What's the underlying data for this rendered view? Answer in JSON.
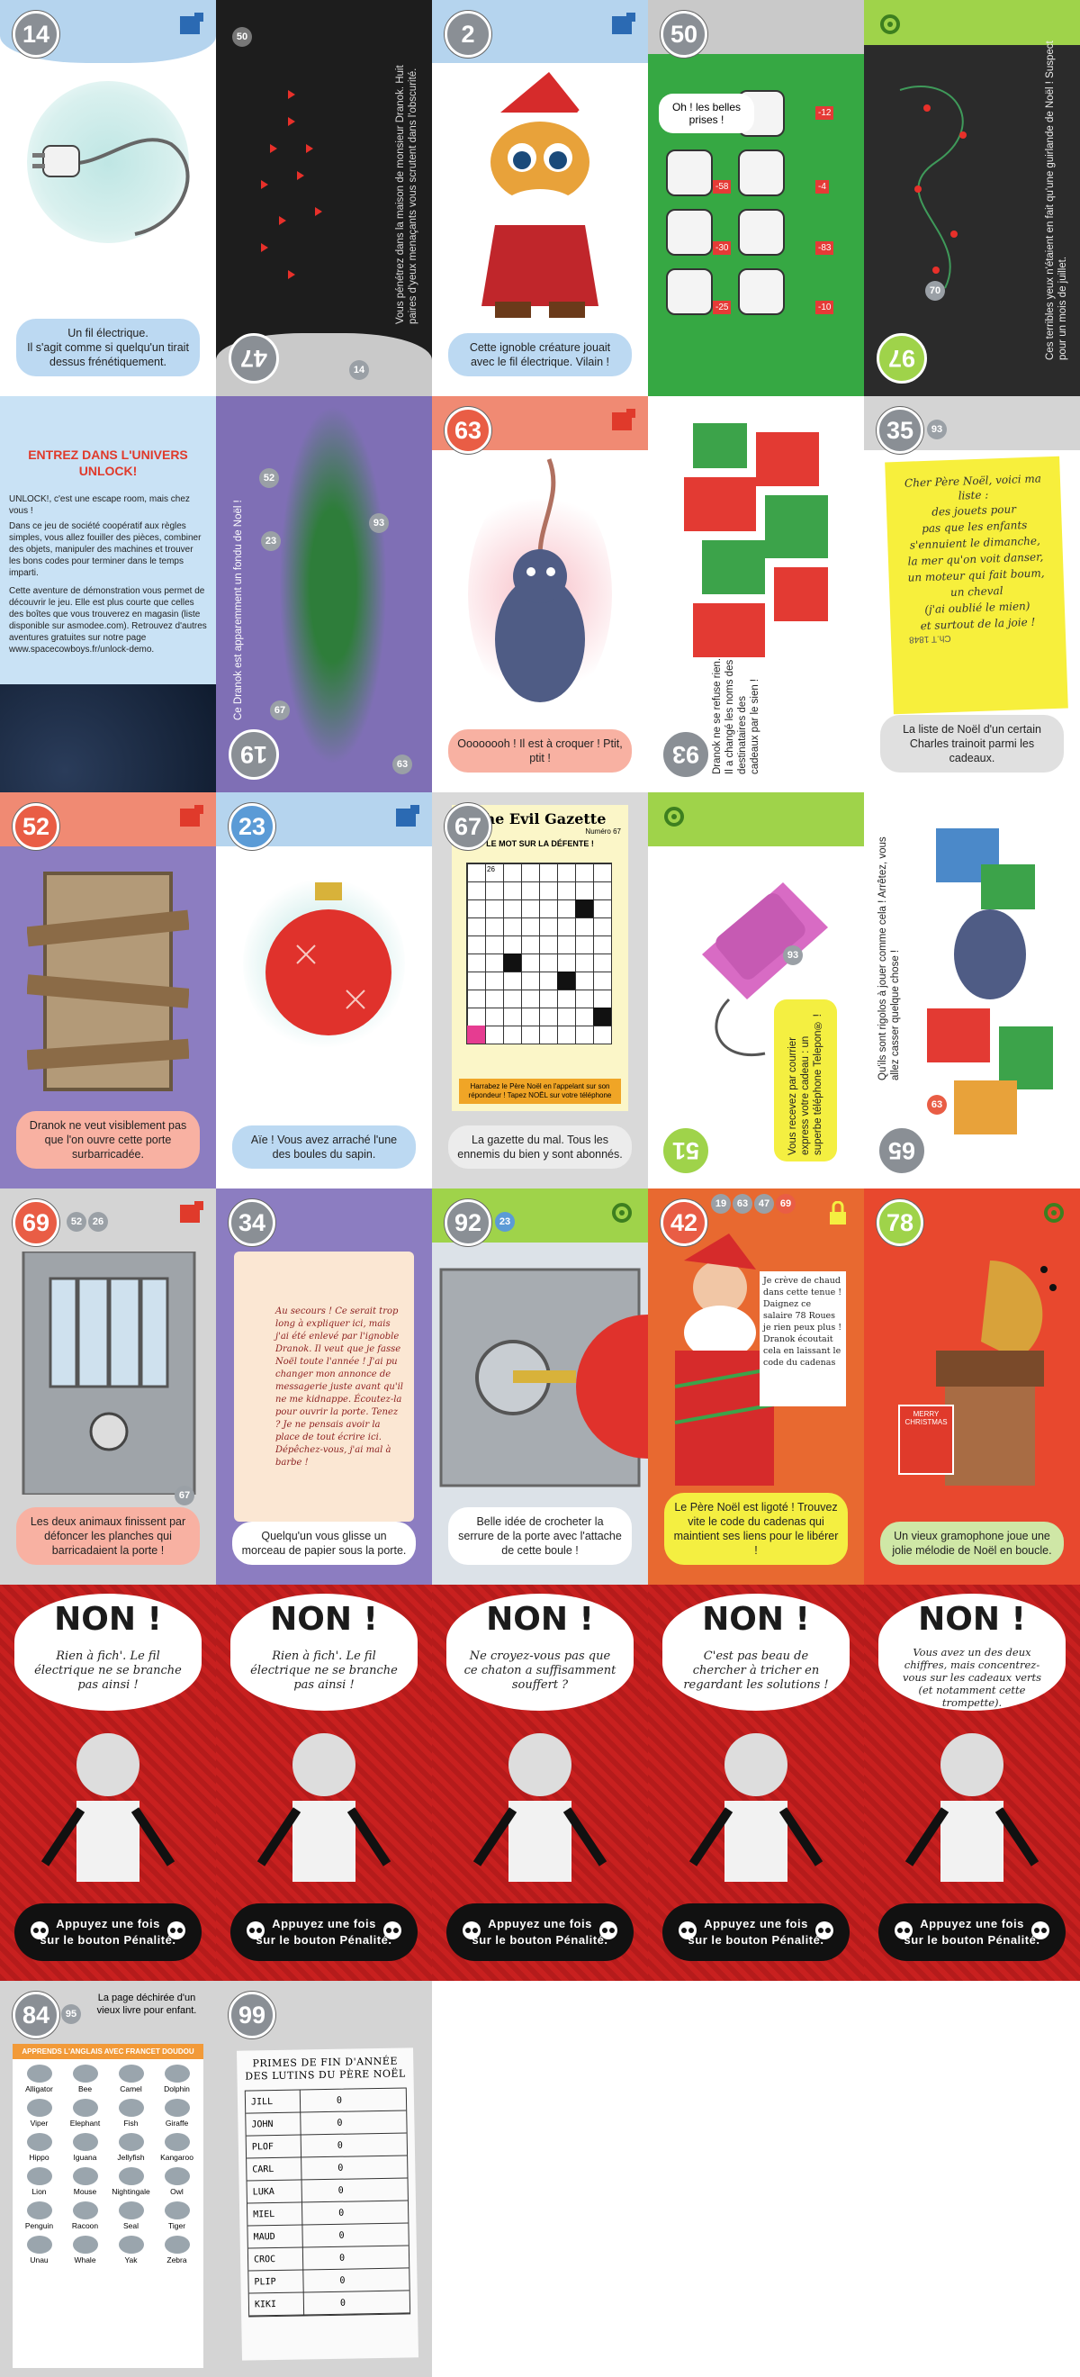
{
  "cards": {
    "c14": {
      "num": "14",
      "caption": "Un fil électrique.\nIl s'agit comme si quelqu'un tirait dessus frénétiquement."
    },
    "c47": {
      "num": "47",
      "small": "50",
      "small2": "14",
      "vert": "Vous pénétrez dans la maison de monsieur Dranok. Huit paires d'yeux menaçants vous scrutent dans l'obscurité."
    },
    "c2": {
      "num": "2",
      "caption": "Cette ignoble créature jouait avec le fil électrique. Vilain !"
    },
    "c50": {
      "num": "50",
      "bubble": "Oh ! les belles prises !",
      "tags": [
        "-12",
        "-58",
        "-4",
        "-30",
        "-83",
        "-25",
        "-10"
      ]
    },
    "c97": {
      "num": "97",
      "small": "70",
      "vert": "Ces terribles yeux n'étaient en fait qu'une guirlande de Noël ! Suspect pour un mois de juillet."
    },
    "intro": {
      "title": "ENTREZ DANS L'UNIVERS UNLOCK!",
      "p1": "UNLOCK!, c'est une escape room, mais chez vous !",
      "p2": "Dans ce jeu de société coopératif aux règles simples, vous allez fouiller des pièces, combiner des objets, manipuler des machines et trouver les bons codes pour terminer dans le temps imparti.",
      "p3": "Cette aventure de démonstration vous permet de découvrir le jeu. Elle est plus courte que celles des boîtes que vous trouverez en magasin (liste disponible sur asmodee.com). Retrouvez d'autres aventures gratuites sur notre page www.spacecowboys.fr/unlock-demo."
    },
    "c19": {
      "num": "19",
      "vert": "Ce Dranok est apparemment un fondu de Noël !",
      "n52": "52",
      "n23": "23",
      "n93": "93",
      "n63": "63",
      "n67": "67"
    },
    "c63": {
      "num": "63",
      "caption": "Oooooooh ! Il est à croquer ! Ptit, ptit !"
    },
    "c93": {
      "num": "93",
      "vert": "Dranok ne se refuse rien. Il a changé les noms des destinataires des cadeaux par le sien !"
    },
    "c35": {
      "num": "35",
      "small": "93",
      "letter": [
        "Cher Père Noël, voici ma liste :",
        "des jouets pour",
        "pas que les enfants",
        "s'ennuient le dimanche,",
        "la mer qu'on voit danser,",
        "un moteur qui fait boum,",
        "un cheval",
        "(j'ai oublié le mien)",
        "et surtout de la joie !"
      ],
      "sign": "Ch.T 1848",
      "caption": "La liste de Noël d'un certain Charles trainoit parmi les cadeaux."
    },
    "c52": {
      "num": "52",
      "caption": "Dranok ne veut visiblement pas que l'on ouvre cette porte surbarricadée."
    },
    "c23": {
      "num": "23",
      "caption": "Aïe ! Vous avez arraché l'une des boules du sapin."
    },
    "c67": {
      "num": "67",
      "gazette": "The Evil Gazette",
      "sub": "Numéro 67",
      "headline": "LE MOT SUR LA DÉFENTE !",
      "grid_num": "26",
      "note": "Harrabez le Père Noël en l'appelant sur son répondeur ! Tapez NOËL sur votre téléphone",
      "caption": "La gazette du mal. Tous les ennemis du bien y sont abonnés."
    },
    "c51": {
      "num": "51",
      "small": "93",
      "vert": "Vous recevez par courrier express votre cadeau : un superbe téléphone Telepon® !"
    },
    "c65": {
      "num": "65",
      "small": "63",
      "vert": "Qu'ils sont rigolos à jouer comme cela ! Arrêtez, vous allez casser quelque chose !"
    },
    "c69": {
      "num": "69",
      "small": [
        "52",
        "26"
      ],
      "n67": "67",
      "caption": "Les deux animaux finissent par défoncer les planches qui barricadaient la porte !"
    },
    "c34": {
      "num": "34",
      "scroll": "Au secours ! Ce serait trop long à expliquer ici, mais j'ai été enlevé par l'ignoble Dranok. Il veut que je fasse Noël toute l'année ! J'ai pu changer mon annonce de messagerie juste avant qu'il ne me kidnappe. Écoutez-la pour ouvrir la porte. Tenez ? Je ne pensais avoir la place de tout écrire ici. Dépêchez-vous, j'ai mal à barbe !",
      "caption": "Quelqu'un vous glisse un morceau de papier sous la porte."
    },
    "c92": {
      "num": "92",
      "small": "23",
      "caption": "Belle idée de crocheter la serrure de la porte avec l'attache de cette boule !"
    },
    "c42": {
      "num": "42",
      "small": [
        "19",
        "63",
        "47",
        "69"
      ],
      "sign": "Je crève de chaud dans cette tenue ! Daignez ce salaire 78 Roues je rien peux plus ! Dranok écoutait cela en laissant le code du cadenas",
      "caption": "Le Père Noël est ligoté ! Trouvez vite le code du cadenas qui maintient ses liens pour le libérer !"
    },
    "c78": {
      "num": "78",
      "record": "MERRY CHRISTMAS",
      "caption": "Un vieux gramophone joue une jolie mélodie de Noël en boucle."
    },
    "non": [
      {
        "title": "NON !",
        "text": "Rien à fich'. Le fil électrique ne se branche pas ainsi !"
      },
      {
        "title": "NON !",
        "text": "Rien à fich'. Le fil électrique ne se branche pas ainsi !"
      },
      {
        "title": "NON !",
        "text": "Ne croyez-vous pas que ce chaton a suffisamment souffert ?"
      },
      {
        "title": "NON !",
        "text": "C'est pas beau de chercher à tricher en regardant les solutions !"
      },
      {
        "title": "NON !",
        "text": "Vous avez un des deux chiffres, mais concentrez-vous sur les cadeaux verts (et notamment cette trompette)."
      }
    ],
    "penalty": [
      "Appuyez une fois",
      "sur le bouton Pénalité."
    ],
    "c84": {
      "num": "84",
      "small": "95",
      "top": "La page déchirée d'un vieux livre pour enfant.",
      "header": "APPRENDS L'ANGLAIS AVEC FRANCET DOUDOU",
      "animals": [
        "Alligator",
        "Bee",
        "Camel",
        "Dolphin",
        "Viper",
        "Elephant",
        "Fish",
        "Giraffe",
        "Hippo",
        "Iguana",
        "Jellyfish",
        "Kangaroo",
        "Lion",
        "Mouse",
        "Nightingale",
        "Owl",
        "Penguin",
        "Racoon",
        "Seal",
        "Tiger",
        "Unau",
        "Whale",
        "Yak",
        "Zebra"
      ]
    },
    "c99": {
      "num": "99",
      "title": "PRIMES DE FIN D'ANNÉE DES LUTINS DU PÈRE NOËL",
      "rows": [
        [
          "JILL",
          "0"
        ],
        [
          "JOHN",
          "0"
        ],
        [
          "PLOF",
          "0"
        ],
        [
          "CARL",
          "0"
        ],
        [
          "LUKA",
          "0"
        ],
        [
          "MIEL",
          "0"
        ],
        [
          "MAUD",
          "0"
        ],
        [
          "CROC",
          "0"
        ],
        [
          "PLIP",
          "0"
        ],
        [
          "KIKI",
          "0"
        ]
      ]
    }
  }
}
